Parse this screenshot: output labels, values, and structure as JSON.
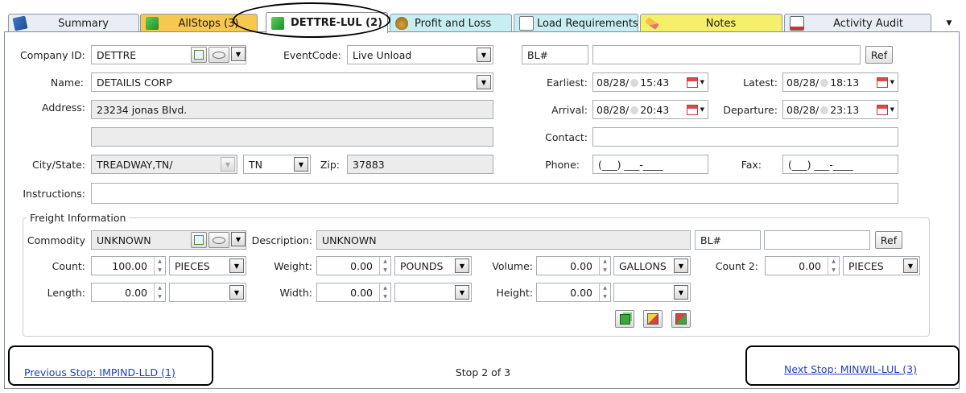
{
  "tabs": [
    {
      "label": "Summary",
      "icon": "book-icon",
      "bg": "#e9eef4"
    },
    {
      "label": "AllStops (3)",
      "icon": "green-box-icon",
      "bg": "#f7c84f"
    },
    {
      "label": "DETTRE-LUL (2)",
      "icon": "green-box-icon",
      "bg": "#ffffff"
    },
    {
      "label": "Profit and Loss",
      "icon": "money-bag-icon",
      "bg": "#c7eef2"
    },
    {
      "label": "Load Requirements",
      "icon": "checklist-icon",
      "bg": "#c7eef2"
    },
    {
      "label": "Notes",
      "icon": "pencil-icon",
      "bg": "#f6ef6a"
    },
    {
      "label": "Activity Audit",
      "icon": "audit-icon",
      "bg": "#e9eef4"
    }
  ],
  "stop": {
    "company_id_label": "Company ID:",
    "company_id": "DETTRE",
    "event_code_label": "EventCode:",
    "event_code": "Live Unload",
    "bl_label": "BL#",
    "bl_value": "",
    "ref_label": "Ref",
    "name_label": "Name:",
    "name": "DETAILIS CORP",
    "address_label": "Address:",
    "address1": "23234 jonas Blvd.",
    "address2": "",
    "city_state_label": "City/State:",
    "city_state": "TREADWAY,TN/",
    "state": "TN",
    "zip_label": "Zip:",
    "zip": "37883",
    "instructions_label": "Instructions:",
    "instructions": "",
    "earliest_label": "Earliest:",
    "earliest_date": "08/28/",
    "earliest_time": "15:43",
    "latest_label": "Latest:",
    "latest_date": "08/28/",
    "latest_time": "18:13",
    "arrival_label": "Arrival:",
    "arrival_date": "08/28/",
    "arrival_time": "20:43",
    "departure_label": "Departure:",
    "departure_date": "08/28/",
    "departure_time": "23:13",
    "contact_label": "Contact:",
    "contact": "",
    "phone_label": "Phone:",
    "phone": "(___) ___-____",
    "fax_label": "Fax:",
    "fax": "(___) ___-____"
  },
  "freight": {
    "group_title": "Freight Information",
    "commodity_label": "Commodity",
    "commodity": "UNKNOWN",
    "description_label": "Description:",
    "description": "UNKNOWN",
    "bl_label": "BL#",
    "bl_value": "",
    "ref_label": "Ref",
    "count_label": "Count:",
    "count": "100.00",
    "count_unit": "PIECES",
    "weight_label": "Weight:",
    "weight": "0.00",
    "weight_unit": "POUNDS",
    "volume_label": "Volume:",
    "volume": "0.00",
    "volume_unit": "GALLONS",
    "count2_label": "Count 2:",
    "count2": "0.00",
    "count2_unit": "PIECES",
    "length_label": "Length:",
    "length": "0.00",
    "length_unit": "",
    "width_label": "Width:",
    "width": "0.00",
    "width_unit": "",
    "height_label": "Height:",
    "height": "0.00",
    "height_unit": ""
  },
  "footer": {
    "prev_stop": "Previous Stop: IMPIND-LLD (1)",
    "stop_position": "Stop 2 of 3",
    "next_stop": "Next Stop: MINWIL-LUL (3)"
  },
  "icons": {
    "dropdown": "▼",
    "spin_up": "▲",
    "spin_down": "▼",
    "overflow_menu": "▼"
  }
}
